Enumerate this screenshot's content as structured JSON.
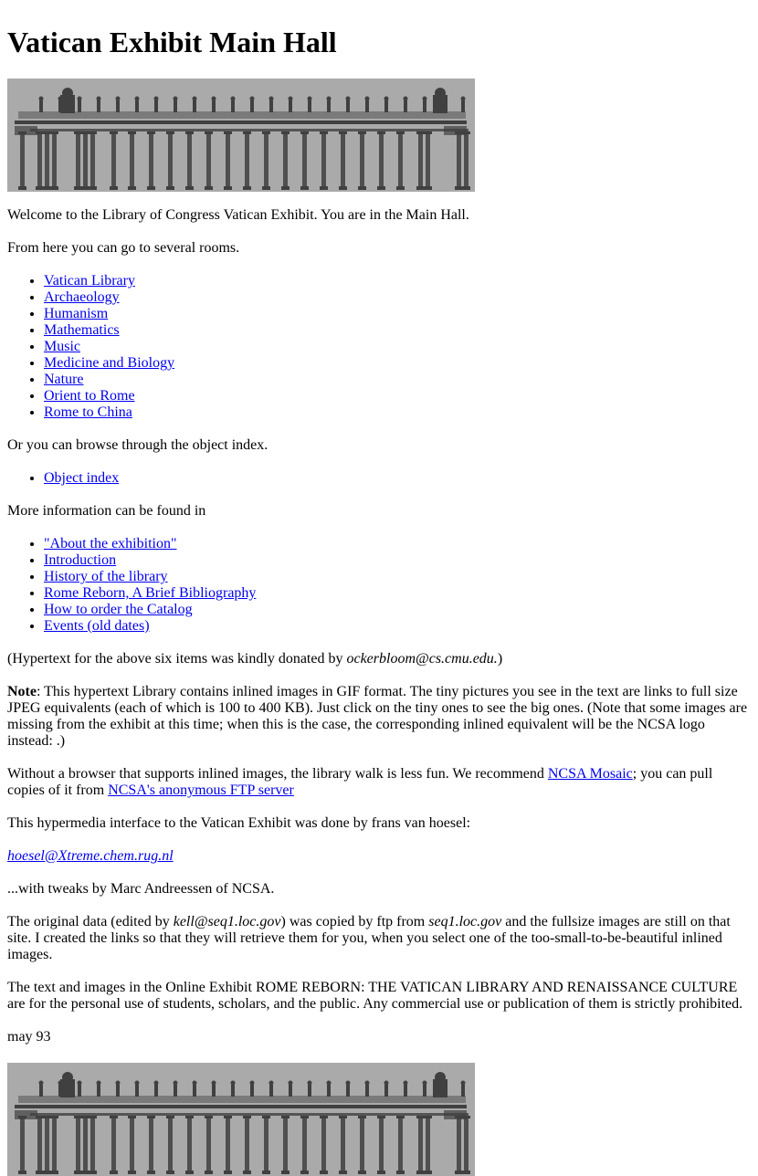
{
  "page": {
    "title": "Vatican Exhibit Main Hall",
    "banner_alt": "colonnade-banner",
    "intro": "Welcome to the Library of Congress Vatican Exhibit. You are in the Main Hall.",
    "rooms_intro": "From here you can go to several rooms.",
    "rooms": [
      {
        "label": "Vatican Library"
      },
      {
        "label": "Archaeology"
      },
      {
        "label": "Humanism"
      },
      {
        "label": "Mathematics"
      },
      {
        "label": "Music"
      },
      {
        "label": "Medicine and Biology"
      },
      {
        "label": "Nature"
      },
      {
        "label": "Orient to Rome"
      },
      {
        "label": "Rome to China"
      }
    ],
    "index_intro": "Or you can browse through the object index.",
    "index_links": [
      {
        "label": "Object index"
      }
    ],
    "more_intro": "More information can be found in",
    "more_links": [
      {
        "label": "\"About the exhibition\""
      },
      {
        "label": "Introduction"
      },
      {
        "label": "History of the library"
      },
      {
        "label": "Rome Reborn, A Brief Bibliography"
      },
      {
        "label": "How to order the Catalog"
      },
      {
        "label": "Events (old dates)"
      }
    ],
    "donation": {
      "prefix": "(Hypertext for the above six items was kindly donated by ",
      "email": "ockerbloom@cs.cmu.edu.",
      "suffix": ")"
    },
    "note": {
      "label": "Note",
      "text": ": This hypertext Library contains inlined images in GIF format. The tiny pictures you see in the text are links to full size JPEG equivalents (each of which is 100 to 400 KB). Just click on the tiny ones to see the big ones. (Note that some images are missing from the exhibit at this time; when this is the case, the corresponding inlined equivalent will be the NCSA logo instead: .)"
    },
    "browser": {
      "prefix": "Without a browser that supports inlined images, the library walk is less fun. We recommend ",
      "mosaic_link": "NCSA Mosaic",
      "middle": "; you can pull copies of it from ",
      "ftp_link": "NCSA's anonymous FTP server"
    },
    "credit": "This hypermedia interface to the Vatican Exhibit was done by frans van hoesel:",
    "author_email": "hoesel@Xtreme.chem.rug.nl",
    "tweaks": "...with tweaks by Marc Andreessen of NCSA.",
    "original": {
      "prefix": "The original data (edited by ",
      "editor": "kell@seq1.loc.gov",
      "middle": ") was copied by ftp from ",
      "host": "seq1.loc.gov",
      "suffix": " and the fullsize images are still on that site. I created the links so that they will retrieve them for you, when you select one of the too-small-to-be-beautiful inlined images."
    },
    "rights": "The text and images in the Online Exhibit ROME REBORN: THE VATICAN LIBRARY AND RENAISSANCE CULTURE are for the personal use of students, scholars, and the public. Any commercial use or publication of them is strictly prohibited.",
    "date": "may 93"
  },
  "colors": {
    "link": "#0000ee",
    "banner_bg": "#aaaaaa",
    "banner_ink": "#404040"
  }
}
